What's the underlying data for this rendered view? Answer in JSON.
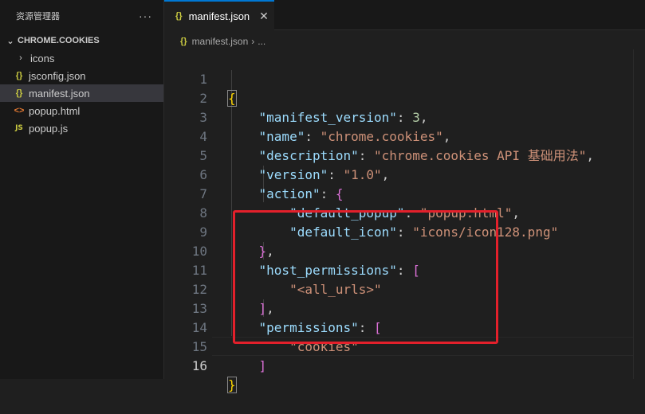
{
  "sidebar": {
    "title": "资源管理器",
    "more": "···",
    "folder": "CHROME.COOKIES",
    "items": [
      {
        "label": "icons",
        "icon": "›",
        "type": "folder"
      },
      {
        "label": "jsconfig.json",
        "icon": "{}",
        "type": "json"
      },
      {
        "label": "manifest.json",
        "icon": "{}",
        "type": "json",
        "selected": true
      },
      {
        "label": "popup.html",
        "icon": "<>",
        "type": "html"
      },
      {
        "label": "popup.js",
        "icon": "JS",
        "type": "js"
      }
    ]
  },
  "tab": {
    "icon": "{}",
    "label": "manifest.json",
    "close": "✕"
  },
  "breadcrumb": {
    "icon": "{}",
    "file": "manifest.json",
    "sep": "›",
    "more": "..."
  },
  "editor": {
    "line_numbers": [
      "1",
      "2",
      "3",
      "4",
      "5",
      "6",
      "7",
      "8",
      "9",
      "10",
      "11",
      "12",
      "13",
      "14",
      "15",
      "16"
    ],
    "active_line": 16,
    "code": {
      "l1_open": "{",
      "l2_key": "\"manifest_version\"",
      "l2_val": "3",
      "l3_key": "\"name\"",
      "l3_val": "\"chrome.cookies\"",
      "l4_key": "\"description\"",
      "l4_val": "\"chrome.cookies API 基础用法\"",
      "l5_key": "\"version\"",
      "l5_val": "\"1.0\"",
      "l6_key": "\"action\"",
      "l6_open": "{",
      "l7_key": "\"default_popup\"",
      "l7_val": "\"popup.html\"",
      "l8_key": "\"default_icon\"",
      "l8_val": "\"icons/icon128.png\"",
      "l9_close": "}",
      "l10_key": "\"host_permissions\"",
      "l10_open": "[",
      "l11_val": "\"<all_urls>\"",
      "l12_close": "]",
      "l13_key": "\"permissions\"",
      "l13_open": "[",
      "l14_val": "\"cookies\"",
      "l15_close": "]",
      "l16_close": "}"
    }
  },
  "colors": {
    "key": "#9cdcfe",
    "string": "#ce9178",
    "number": "#b5cea8",
    "bracket_level1": "#ffd700",
    "bracket_level2": "#da70d6",
    "bracket_level3": "#179fff",
    "highlight_box": "#e3202b",
    "tab_accent": "#0078d4"
  }
}
